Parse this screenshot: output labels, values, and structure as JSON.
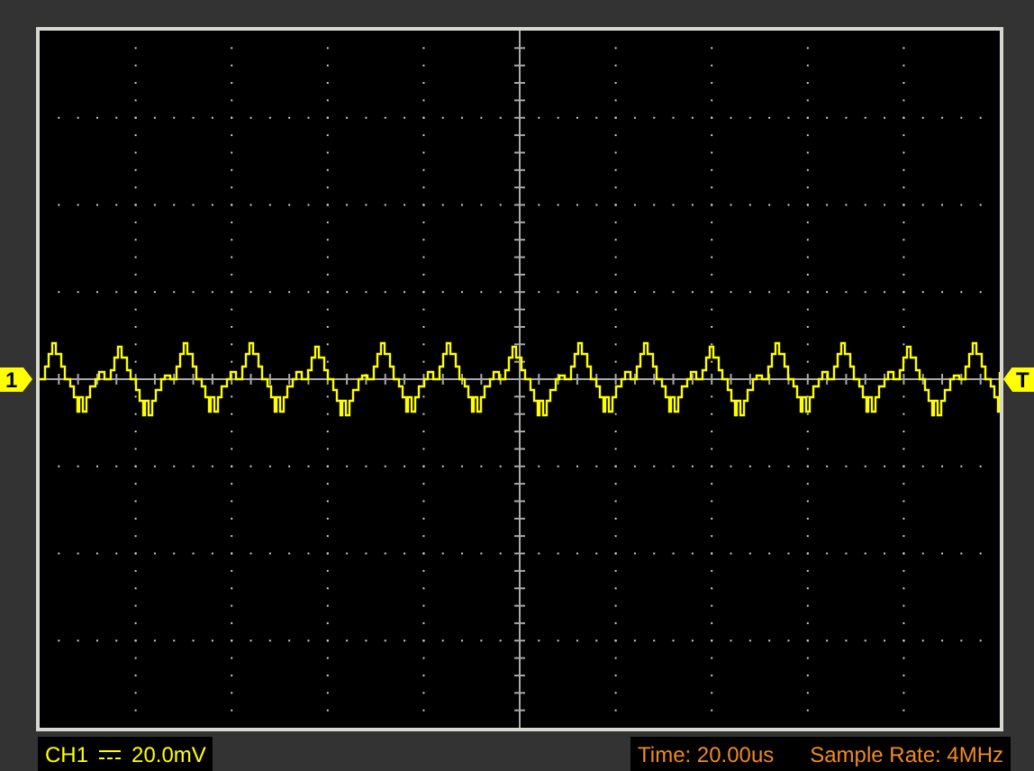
{
  "channel_marker": "1",
  "trigger_marker": "T",
  "status": {
    "channel": "CH1",
    "volts_div": "20.0mV",
    "time": "Time: 20.00us",
    "sample_rate": "Sample Rate: 4MHz"
  }
}
